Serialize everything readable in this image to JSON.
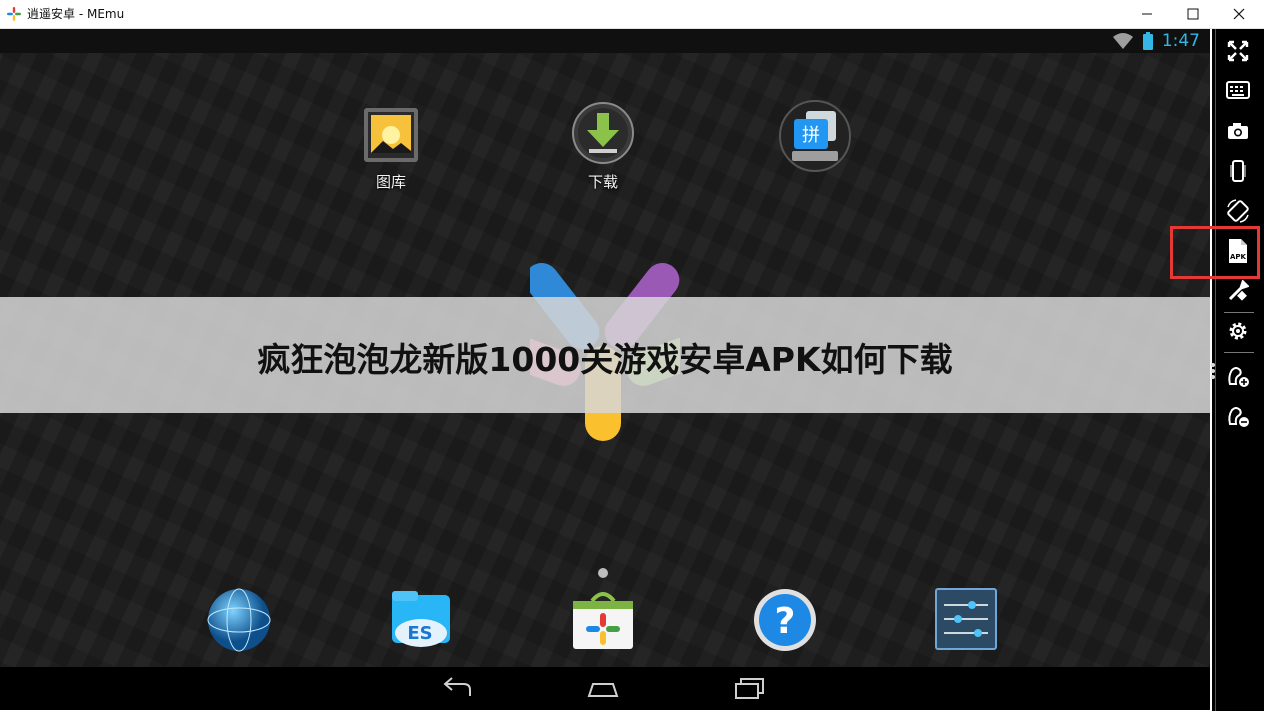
{
  "window": {
    "title": "逍遥安卓 - MEmu",
    "controls": {
      "minimize": "—",
      "maximize": "☐",
      "close": "✕"
    }
  },
  "statusbar": {
    "time": "1:47",
    "wifi_icon": "wifi-icon",
    "battery_icon": "battery-icon"
  },
  "home_apps": [
    {
      "label": "图库",
      "icon": "gallery-icon"
    },
    {
      "label": "下载",
      "icon": "download-icon"
    },
    {
      "label": "",
      "icon": "pinyin-keyboard-icon",
      "icon_text": "拼"
    }
  ],
  "banner": {
    "title": "疯狂泡泡龙新版1000关游戏安卓APK如何下载"
  },
  "dock": [
    {
      "icon": "browser-globe-icon"
    },
    {
      "icon": "es-file-explorer-icon",
      "icon_text": "ES"
    },
    {
      "icon": "app-market-icon"
    },
    {
      "icon": "help-icon",
      "icon_text": "?"
    },
    {
      "icon": "settings-sliders-icon"
    }
  ],
  "navbar": [
    "back-icon",
    "home-icon",
    "recent-apps-icon"
  ],
  "toolbar": [
    "fullscreen-icon",
    "keyboard-icon",
    "screenshot-camera-icon",
    "shake-phone-icon",
    "rotate-screen-icon",
    "install-apk-icon",
    "tools-icon",
    "settings-gear-icon",
    "volume-up-icon",
    "volume-down-icon"
  ],
  "toolbar_apk_text": "APK",
  "colors": {
    "accent_clock": "#33b5e5",
    "highlight_box": "#e53935",
    "banner_bg": "#d6d6d6"
  }
}
